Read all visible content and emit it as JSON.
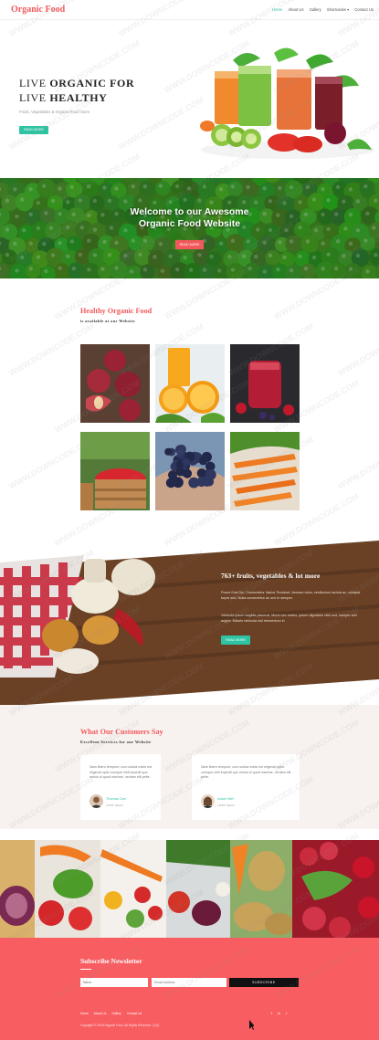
{
  "header": {
    "logo": "Organic Food",
    "nav": [
      "Home",
      "About Us",
      "Gallery",
      "Shortcodes ▾",
      "Contact Us"
    ]
  },
  "hero": {
    "title_line1_prefix": "LIVE ",
    "title_line1_bold": "ORGANIC FOR",
    "title_line2_prefix": "LIVE ",
    "title_line2_bold": "HEALTHY",
    "subtitle": "Fruits, Vegetables & Organic Food Store",
    "button": "READ MORE",
    "slides_active": 2,
    "slides_total": 4
  },
  "peas": {
    "headline_line1": "Welcome to our Awesome",
    "headline_line2": "Organic Food Website",
    "button": "READ MORE"
  },
  "gallery": {
    "title": "Healthy Organic Food",
    "subtitle": "is available at our Website",
    "items": [
      "plums",
      "oranges-juice",
      "berry-smoothie",
      "tomato-basket",
      "blueberries",
      "carrots"
    ]
  },
  "stats": {
    "title": "763+ fruits, vegetables & lot more",
    "para1": "Fusce Erat Dui, Consectetur Varius Tincidunt. Aenean dolor, vestibulum lacinia ac, volutpat turpis sed. Nulla consectetur ac orci in semper.",
    "para2": "Vehicula ipsum sagittis placerat. Morbi nec metus, ipsum dignissim nibh aut, semper sed augue. Mauris vehicula nisl elementum in",
    "button": "READ MORE"
  },
  "testimonials": {
    "title": "What Our Customers Say",
    "subtitle": "Excellent Services for our Website",
    "cards": [
      {
        "text": "Nam libero tempore, cum soluta nobis est eligendi optio cumque nihil impedit quo minus id quod maxime, veniam elit pelte.",
        "name": "Thomas Carl",
        "role": "Lorem Ipsum"
      },
      {
        "text": "Nam libero tempore, cum soluta nobis est eligendi optio cumque nihil impedit quo minus id quod maxime, veniam elit pelte.",
        "name": "Adam Wet",
        "role": "Lorem Ipsum"
      }
    ]
  },
  "newsletter": {
    "title": "Subscribe Newsletter",
    "name_placeholder": "Name",
    "email_placeholder": "Email Address",
    "button": "SUBSCRIBE"
  },
  "footer": {
    "links": [
      "Home",
      "About Us",
      "Gallery",
      "Contact Us"
    ],
    "social": [
      "f",
      "in",
      "t"
    ],
    "copyright": "Copyright © 2018 Organic Food. All Rights Reserved. ▯▯▯▯"
  },
  "watermark": "WWW.DOWNCODE.COM",
  "colors": {
    "accent": "#f2585b",
    "green": "#2ec4a3",
    "footer": "#f85d61"
  }
}
